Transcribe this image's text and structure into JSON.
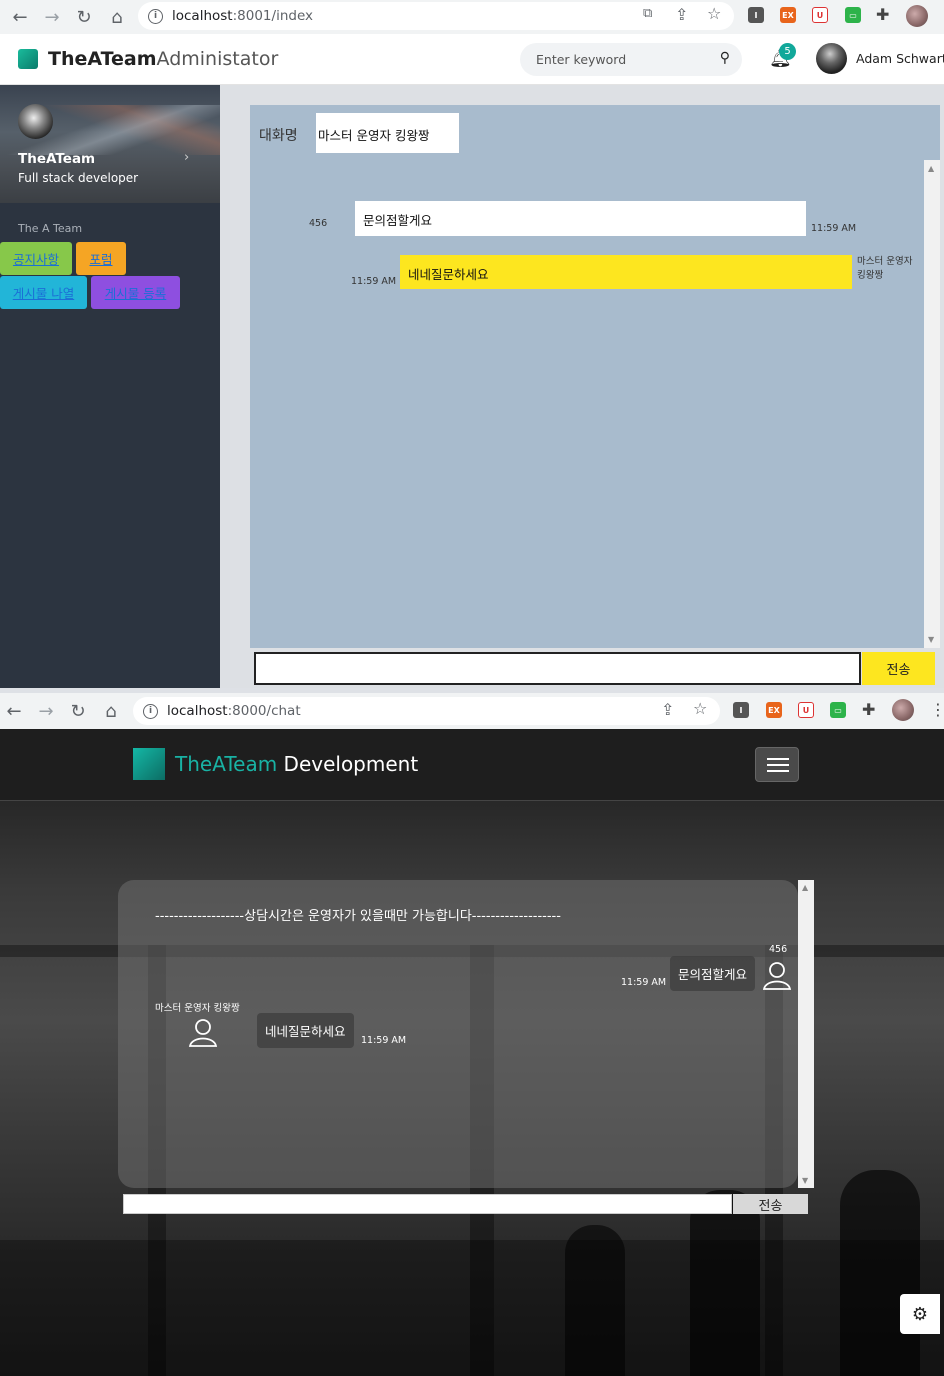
{
  "top_browser": {
    "url_host": "localhost",
    "url_rest": ":8001/index"
  },
  "admin": {
    "brand_bold": "TheATeam",
    "brand_light": "Administator",
    "search_placeholder": "Enter keyword",
    "notification_count": "5",
    "user_name": "Adam Schwartz",
    "sidebar": {
      "name": "TheATeam",
      "role": "Full stack developer",
      "section": "The A Team",
      "buttons": [
        "공지사항",
        "포럼",
        "게시물 나열",
        "게시물 등록"
      ]
    },
    "chat": {
      "label": "대화명",
      "name_value": "마스터 운영자 킹왕짱",
      "messages": [
        {
          "sender": "456",
          "text": "문의점할게요",
          "time": "11:59 AM"
        },
        {
          "sender": "마스터 운영자 킹왕짱",
          "text": "네네질문하세요",
          "time": "11:59 AM"
        }
      ],
      "send_label": "전송"
    }
  },
  "bottom_browser": {
    "url_host": "localhost",
    "url_rest": ":8000/chat"
  },
  "client": {
    "brand_teal": "TheATeam",
    "brand_white": "Development",
    "notice": "-------------------상담시간은 운영자가 있을때만 가능합니다-------------------",
    "messages": [
      {
        "sender": "456",
        "text": "문의점할게요",
        "time": "11:59 AM"
      },
      {
        "sender": "마스터 운영자 킹왕짱",
        "text": "네네질문하세요",
        "time": "11:59 AM"
      }
    ],
    "send_label": "전송"
  },
  "colors": {
    "teal": "#19b2a4",
    "yellow": "#fde61f",
    "chat_bg": "#a8bbcd",
    "sidebar": "#2c3440"
  },
  "icons": [
    "back-icon",
    "forward-icon",
    "reload-icon",
    "home-icon",
    "info-icon",
    "translate-icon",
    "share-icon",
    "star-icon",
    "puzzle-icon",
    "bell-icon",
    "search-icon",
    "chevron-right-icon",
    "user-icon",
    "gear-icon",
    "hamburger-icon"
  ]
}
